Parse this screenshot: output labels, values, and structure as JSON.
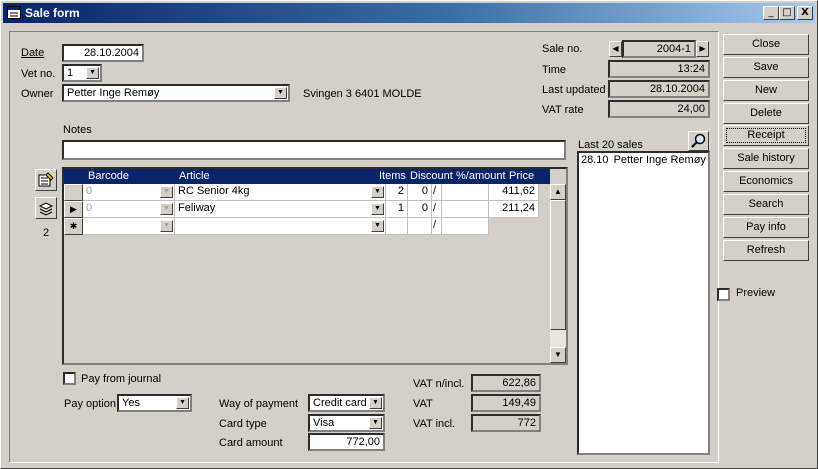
{
  "window": {
    "title": "Sale form",
    "min": "_",
    "max": "□",
    "close": "X"
  },
  "form": {
    "date_label": "Date",
    "date_value": "28.10.2004",
    "vet_label": "Vet no.",
    "vet_value": "1",
    "owner_label": "Owner",
    "owner_value": "Petter Inge Remøy",
    "owner_address": "Svingen 3 6401 MOLDE",
    "notes_label": "Notes",
    "notes_value": ""
  },
  "sale": {
    "sale_no_label": "Sale no.",
    "sale_no_value": "2004-1",
    "time_label": "Time",
    "time_value": "13:24",
    "last_updated_label": "Last updated",
    "last_updated_value": "28.10.2004",
    "vat_rate_label": "VAT rate",
    "vat_rate_value": "24,00"
  },
  "grid": {
    "headers": {
      "barcode": "Barcode",
      "article": "Article",
      "items": "Items",
      "discount": "Discount",
      "amount": "%/amount",
      "price": "Price"
    },
    "rows": [
      {
        "barcode": "0",
        "article": "RC Senior 4kg",
        "items": "2",
        "discount": "0",
        "type": "/",
        "price": "411,62",
        "selector": ""
      },
      {
        "barcode": "0",
        "article": "Feliway",
        "items": "1",
        "discount": "0",
        "type": "/",
        "price": "211,24",
        "selector": "▶"
      },
      {
        "barcode": "",
        "article": "",
        "items": "",
        "discount": "",
        "type": "/",
        "price": "",
        "selector": "✱"
      }
    ],
    "count": "2"
  },
  "payment": {
    "pay_from_journal": "Pay from journal",
    "pay_option_label": "Pay option",
    "pay_option_value": "Yes",
    "way_label": "Way of payment",
    "way_value": "Credit card",
    "card_type_label": "Card type",
    "card_type_value": "Visa",
    "card_amount_label": "Card amount",
    "card_amount_value": "772,00"
  },
  "totals": {
    "vat_excl_label": "VAT n/incl.",
    "vat_excl_value": "622,86",
    "vat_label": "VAT",
    "vat_value": "149,49",
    "vat_incl_label": "VAT incl.",
    "vat_incl_value": "772"
  },
  "last_sales": {
    "label": "Last 20 sales",
    "items": [
      {
        "date": "28.10",
        "name": "Petter Inge Remøy"
      }
    ]
  },
  "buttons": {
    "close": "Close",
    "save": "Save",
    "new": "New",
    "delete": "Delete",
    "receipt": "Receipt",
    "sale_history": "Sale history",
    "economics": "Economics",
    "search": "Search",
    "pay_info": "Pay info",
    "refresh": "Refresh"
  },
  "preview_label": "Preview",
  "icons": {
    "dropdown": "▼",
    "nav_prev": "◀",
    "nav_next": "▶",
    "scroll_up": "▲",
    "scroll_down": "▼"
  }
}
